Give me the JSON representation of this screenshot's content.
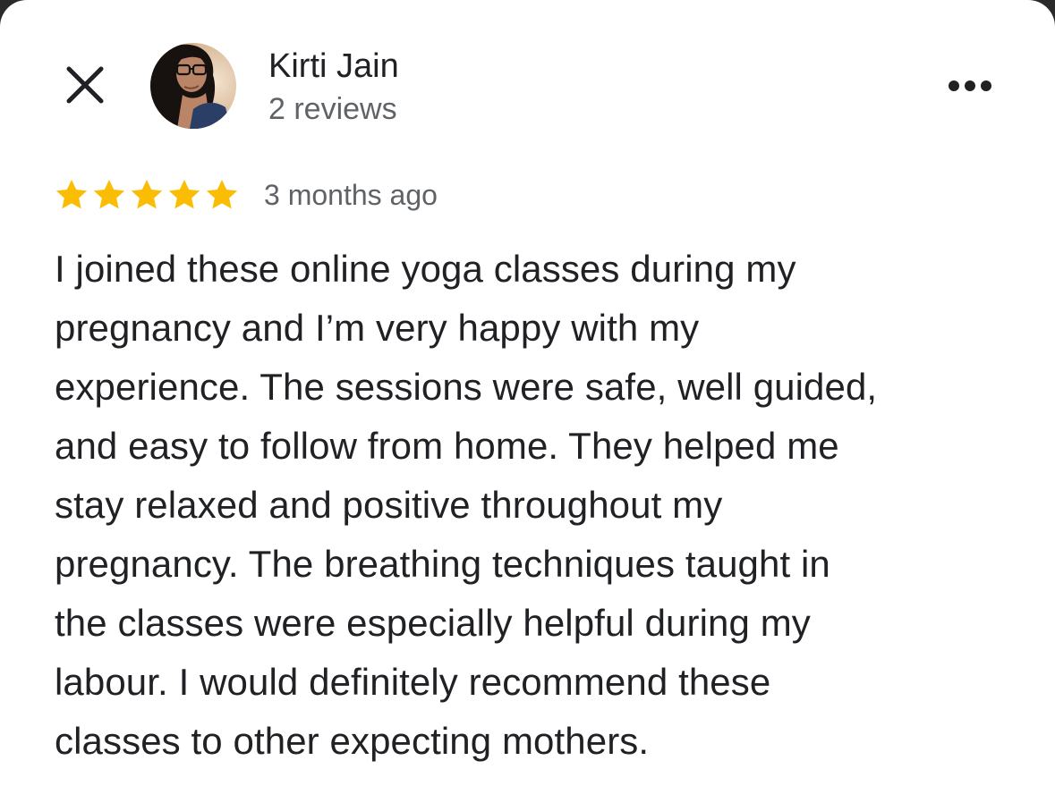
{
  "reviewer": {
    "name": "Kirti Jain",
    "review_count": "2 reviews",
    "avatar_icon": "person-photo"
  },
  "header": {
    "close_icon": "close-icon",
    "more_icon": "more-horizontal-icon"
  },
  "review": {
    "rating": 5,
    "max_rating": 5,
    "star_color": "#FBBC04",
    "time": "3 months ago",
    "lines": [
      "I joined these online yoga classes during my",
      "pregnancy and I’m very happy with my",
      "experience. The sessions were safe, well guided,",
      "and easy to follow from home. They helped me",
      "stay relaxed and positive throughout my",
      "pregnancy. The breathing techniques taught in",
      "the classes were especially helpful during my",
      "labour. I would definitely recommend these",
      "classes to other expecting mothers."
    ]
  }
}
